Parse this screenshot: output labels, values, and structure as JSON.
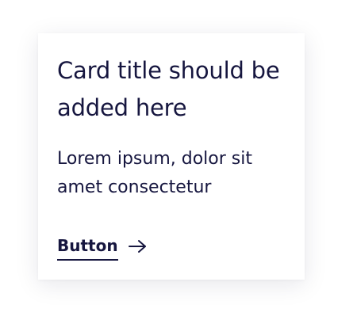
{
  "card": {
    "title": "Card title should be added here",
    "body": "Lorem ipsum, dolor sit amet consectetur",
    "button_label": "Button",
    "button_icon": "arrow-right-icon"
  },
  "colors": {
    "text": "#16163f",
    "background": "#ffffff"
  }
}
